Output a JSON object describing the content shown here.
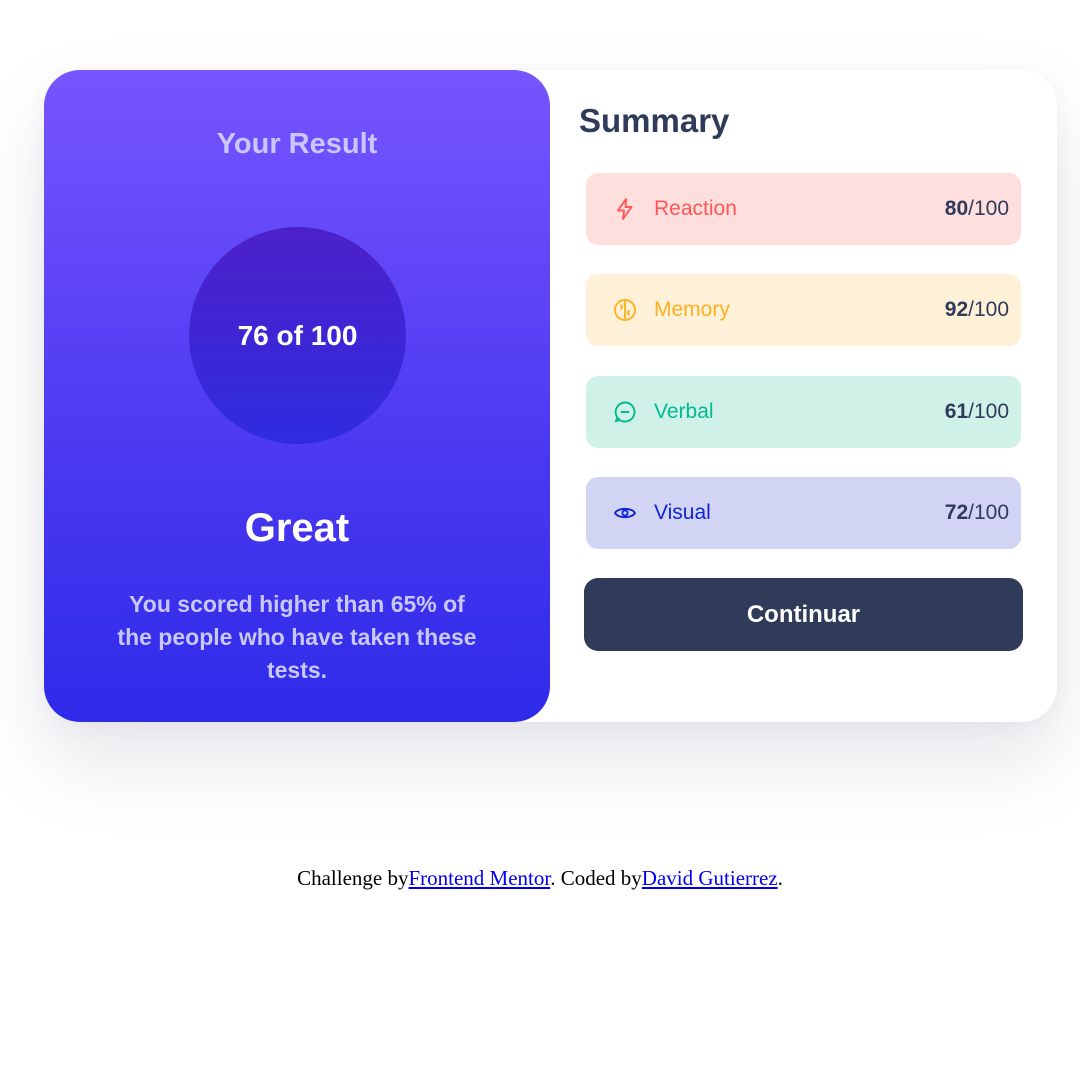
{
  "result": {
    "title": "Your Result",
    "score": "76 of 100",
    "verdict": "Great",
    "description": "You scored higher than 65% of the people who have taken these tests."
  },
  "summary": {
    "title": "Summary",
    "items": [
      {
        "label": "Reaction",
        "score": "80",
        "total": "/100",
        "icon": "lightning-icon",
        "color": "#ff5757",
        "bg": "#ffdede"
      },
      {
        "label": "Memory",
        "score": "92",
        "total": "/100",
        "icon": "brain-icon",
        "color": "#ffb021",
        "bg": "#fff1d8"
      },
      {
        "label": "Verbal",
        "score": "61",
        "total": "/100",
        "icon": "chat-bubble-icon",
        "color": "#00bb8f",
        "bg": "#cff1e8"
      },
      {
        "label": "Visual",
        "score": "72",
        "total": "/100",
        "icon": "eye-icon",
        "color": "#1125d6",
        "bg": "#d2d4f4"
      }
    ],
    "button_label": "Continuar"
  },
  "attribution": {
    "prefix": "Challenge by",
    "link1": "Frontend Mentor",
    "middle": ". Coded by",
    "link2": "David Gutierrez",
    "suffix": "."
  },
  "colors": {
    "gradient_top": "#7755ff",
    "gradient_bottom": "#2e2be9",
    "dark_navy": "#303b5a"
  }
}
